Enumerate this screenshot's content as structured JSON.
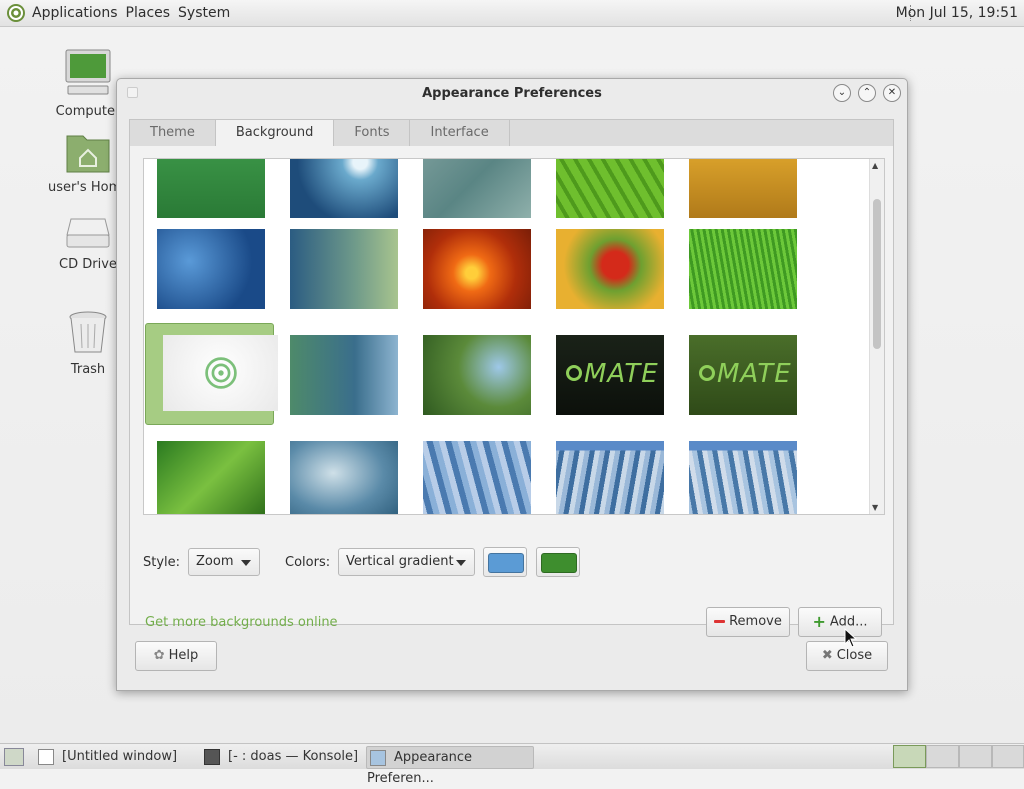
{
  "top_panel": {
    "menus": [
      "Applications",
      "Places",
      "System"
    ],
    "clock": "Mon Jul 15, 19:51"
  },
  "desktop_icons": [
    {
      "label": "Computer",
      "icon": "computer-icon"
    },
    {
      "label": "user's Home",
      "icon": "home-folder-icon"
    },
    {
      "label": "CD Drive",
      "icon": "cd-drive-icon"
    },
    {
      "label": "Trash",
      "icon": "trash-icon"
    }
  ],
  "window": {
    "title": "Appearance Preferences",
    "tabs": [
      "Theme",
      "Background",
      "Fonts",
      "Interface"
    ],
    "active_tab": "Background",
    "style_label": "Style:",
    "style_value": "Zoom",
    "colors_label": "Colors:",
    "colors_value": "Vertical gradient",
    "primary_color": "#5b9bd5",
    "secondary_color": "#3e8e2e",
    "get_more_link": "Get more backgrounds online",
    "remove_label": "Remove",
    "add_label": "Add...",
    "help_label": "Help",
    "close_label": "Close",
    "wallpapers": [
      {
        "kind": "green-plain"
      },
      {
        "kind": "water-drop"
      },
      {
        "kind": "teal-waves"
      },
      {
        "kind": "green-leaf"
      },
      {
        "kind": "wheat-field"
      },
      {
        "kind": "blue-drops"
      },
      {
        "kind": "blue-green-gradient"
      },
      {
        "kind": "orange-flower"
      },
      {
        "kind": "red-flower"
      },
      {
        "kind": "green-grass"
      },
      {
        "kind": "mate-logo-white",
        "selected": true
      },
      {
        "kind": "teal-blue-swirl"
      },
      {
        "kind": "ladybug-plant"
      },
      {
        "kind": "mate-dark",
        "text": "MATE"
      },
      {
        "kind": "mate-green",
        "text": "MATE"
      },
      {
        "kind": "green-leaves"
      },
      {
        "kind": "blue-curves"
      },
      {
        "kind": "abstract-blue-1"
      },
      {
        "kind": "abstract-blue-2"
      },
      {
        "kind": "abstract-blue-3"
      }
    ]
  },
  "taskbar": {
    "tasks": [
      {
        "label": "[Untitled window]",
        "icon": "window-icon"
      },
      {
        "label": "[- : doas — Konsole]",
        "icon": "terminal-icon"
      },
      {
        "label": "Appearance Preferen...",
        "icon": "appearance-icon",
        "active": true
      }
    ]
  }
}
